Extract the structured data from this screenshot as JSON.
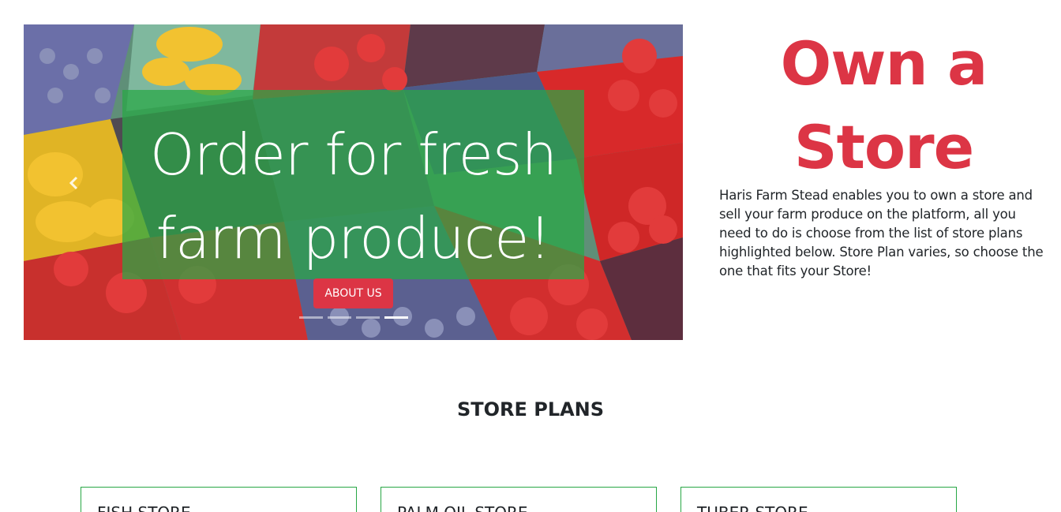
{
  "hero": {
    "caption": "Order for fresh farm produce!",
    "about_button": "ABOUT US",
    "prev_icon": "chevron-left-icon",
    "indicator_count": 4,
    "active_indicator": 4,
    "image_description": "produce-baskets-photo"
  },
  "promo": {
    "title": "Own a Store",
    "body": "Haris Farm Stead enables you to own a store and sell your farm produce on the platform, all you need to do is choose from the list of store plans highlighted below. Store Plan varies, so choose the one that fits your Store!"
  },
  "plans": {
    "heading": "STORE PLANS",
    "cards": [
      {
        "title": "FISH STORE"
      },
      {
        "title": "PALM OIL STORE"
      },
      {
        "title": "TUBER STORE"
      }
    ]
  },
  "colors": {
    "accent": "#dc3545",
    "caption_overlay": "#28a745",
    "card_border": "#28a745"
  }
}
